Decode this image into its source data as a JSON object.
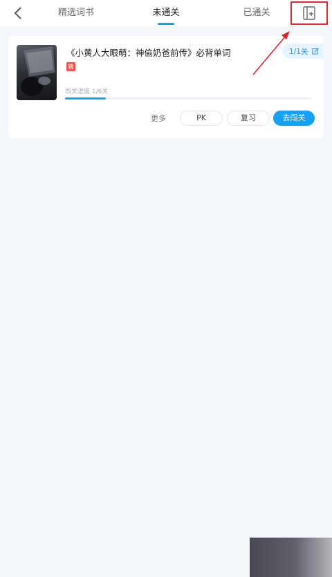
{
  "header": {
    "tabs": [
      {
        "label": "精选词书",
        "active": false
      },
      {
        "label": "未通关",
        "active": true
      },
      {
        "label": "已通关",
        "active": false
      }
    ],
    "icons": {
      "back": "chevron-left-icon",
      "add_book": "book-plus-icon"
    }
  },
  "book": {
    "title": "《小黄人大眼萌：神偷奶爸前传》必背单词",
    "tag": "精",
    "level_badge": "1/1关",
    "progress_label": "闯关进度 1/6关",
    "progress": {
      "current": 1,
      "total": 6
    },
    "actions": {
      "more": "更多",
      "pk": "PK",
      "review": "复习",
      "go": "去闯关"
    }
  },
  "colors": {
    "accent": "#17a0f5",
    "tag": "#f0554b",
    "highlight": "#e0252a"
  }
}
